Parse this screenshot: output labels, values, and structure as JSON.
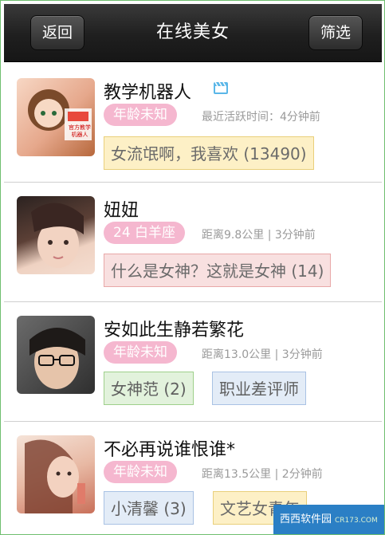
{
  "nav": {
    "title": "在线美女",
    "back_label": "返回",
    "filter_label": "筛选"
  },
  "colors": {
    "badge": "#f5b7cf",
    "nav_bg": "#222222"
  },
  "users": [
    {
      "name": "教学机器人",
      "badge": "年龄未知",
      "meta": "最近活跃时间：4分钟前",
      "has_video_icon": true,
      "avatar_text": [
        "官方教学",
        "机器人"
      ],
      "tags": [
        {
          "text": "女流氓啊，我喜欢 (13490)",
          "color": "yellow"
        }
      ]
    },
    {
      "name": "妞妞",
      "badge": "24 白羊座",
      "meta": "距离9.8公里 | 3分钟前",
      "tags": [
        {
          "text": "什么是女神？这就是女神 (14)",
          "color": "pink"
        }
      ]
    },
    {
      "name": "安如此生静若繁花",
      "badge": "年龄未知",
      "meta": "距离13.0公里 | 3分钟前",
      "tags": [
        {
          "text": "女神范 (2)",
          "color": "green"
        },
        {
          "text": "职业差评师",
          "color": "blue"
        }
      ]
    },
    {
      "name": "不必再说谁恨谁*",
      "badge": "年龄未知",
      "meta": "距离13.5公里 | 2分钟前",
      "tags": [
        {
          "text": "小清馨 (3)",
          "color": "blue"
        },
        {
          "text": "文艺女青年",
          "color": "yellow"
        }
      ]
    }
  ],
  "watermark": {
    "text": "西西软件园",
    "sub": "CR173.COM"
  }
}
